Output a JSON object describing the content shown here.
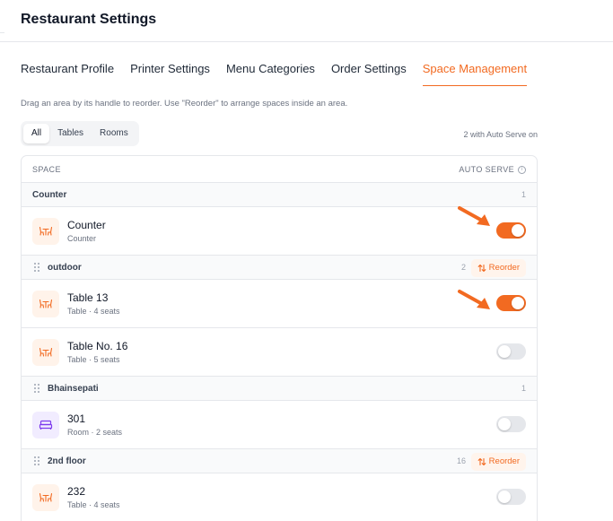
{
  "page": {
    "title": "Restaurant Settings"
  },
  "tabs": [
    {
      "label": "Restaurant Profile",
      "active": false
    },
    {
      "label": "Printer Settings",
      "active": false
    },
    {
      "label": "Menu Categories",
      "active": false
    },
    {
      "label": "Order Settings",
      "active": false
    },
    {
      "label": "Space Management",
      "active": true
    }
  ],
  "hint": "Drag an area by its handle to reorder. Use \"Reorder\" to arrange spaces inside an area.",
  "filter": {
    "options": [
      "All",
      "Tables",
      "Rooms"
    ],
    "selected": "All"
  },
  "auto_serve_count": "2 with Auto Serve on",
  "table": {
    "col_space": "SPACE",
    "col_auto": "AUTO SERVE",
    "reorder_label": "Reorder",
    "groups": [
      {
        "name": "Counter",
        "count": "1",
        "draggable": false,
        "reorder": false,
        "items": [
          {
            "name": "Counter",
            "sub": "Counter",
            "type": "table",
            "auto_serve": true
          }
        ]
      },
      {
        "name": "outdoor",
        "count": "2",
        "draggable": true,
        "reorder": true,
        "items": [
          {
            "name": "Table 13",
            "sub": "Table · 4 seats",
            "type": "table",
            "auto_serve": true
          },
          {
            "name": "Table No. 16",
            "sub": "Table · 5 seats",
            "type": "table",
            "auto_serve": false
          }
        ]
      },
      {
        "name": "Bhainsepati",
        "count": "1",
        "draggable": true,
        "reorder": false,
        "items": [
          {
            "name": "301",
            "sub": "Room · 2 seats",
            "type": "room",
            "auto_serve": false
          }
        ]
      },
      {
        "name": "2nd floor",
        "count": "16",
        "draggable": true,
        "reorder": true,
        "items": [
          {
            "name": "232",
            "sub": "Table · 4 seats",
            "type": "table",
            "auto_serve": false
          }
        ]
      }
    ]
  },
  "colors": {
    "accent": "#f26a21",
    "table_icon": "#f26a21",
    "room_icon": "#7c3aed",
    "toggle_off": "#e5e7eb"
  },
  "icons": {
    "table": "table-chairs-icon",
    "room": "bed-icon",
    "handle": "drag-handle-icon",
    "reorder": "reorder-arrows-icon",
    "info": "info-icon",
    "annotation": "annotation-arrow-icon"
  }
}
